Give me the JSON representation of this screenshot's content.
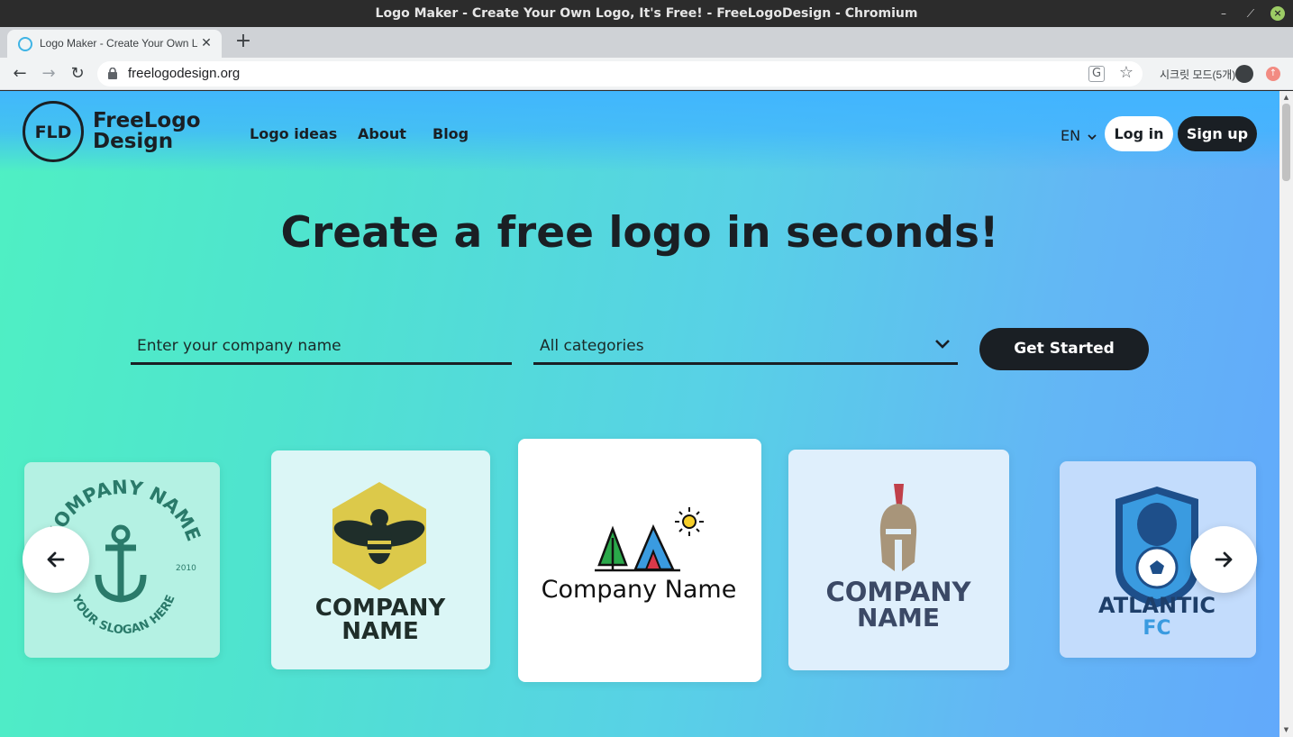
{
  "window": {
    "title": "Logo Maker - Create Your Own Logo, It's Free! - FreeLogoDesign - Chromium",
    "minimize_glyph": "–",
    "restore_glyph": "⟋",
    "close_glyph": "×"
  },
  "browser": {
    "tab_title": "Logo Maker - Create Your Own Logo",
    "tab_close": "✕",
    "new_tab": "+",
    "url": "freelogodesign.org",
    "back": "←",
    "forward": "→",
    "reload": "↻",
    "translate_glyph": "G",
    "star_glyph": "☆",
    "incognito_label": "시크릿 모드(5개)",
    "extension_glyph": "↑"
  },
  "site": {
    "brand": {
      "mark": "FLD",
      "name_line1": "FreeLogo",
      "name_line2": "Design"
    },
    "nav": [
      "Logo ideas",
      "About",
      "Blog"
    ],
    "lang": "EN",
    "login": "Log in",
    "signup": "Sign up",
    "hero_title": "Create a free logo in seconds!",
    "company_placeholder": "Enter your company name",
    "category_value": "All categories",
    "cta": "Get Started",
    "carousel": [
      {
        "line1": "COMPANY NAME",
        "line2": "YOUR SLOGAN HERE",
        "year": "2010"
      },
      {
        "line1": "COMPANY",
        "line2": "NAME"
      },
      {
        "line1": "Company Name"
      },
      {
        "line1": "COMPANY",
        "line2": "NAME"
      },
      {
        "line1": "ATLANTIC",
        "line2": "FC"
      }
    ]
  },
  "colors": {
    "dark": "#1a1f24",
    "gradient_start": "#4ff0c3",
    "gradient_end": "#62a9fb"
  }
}
